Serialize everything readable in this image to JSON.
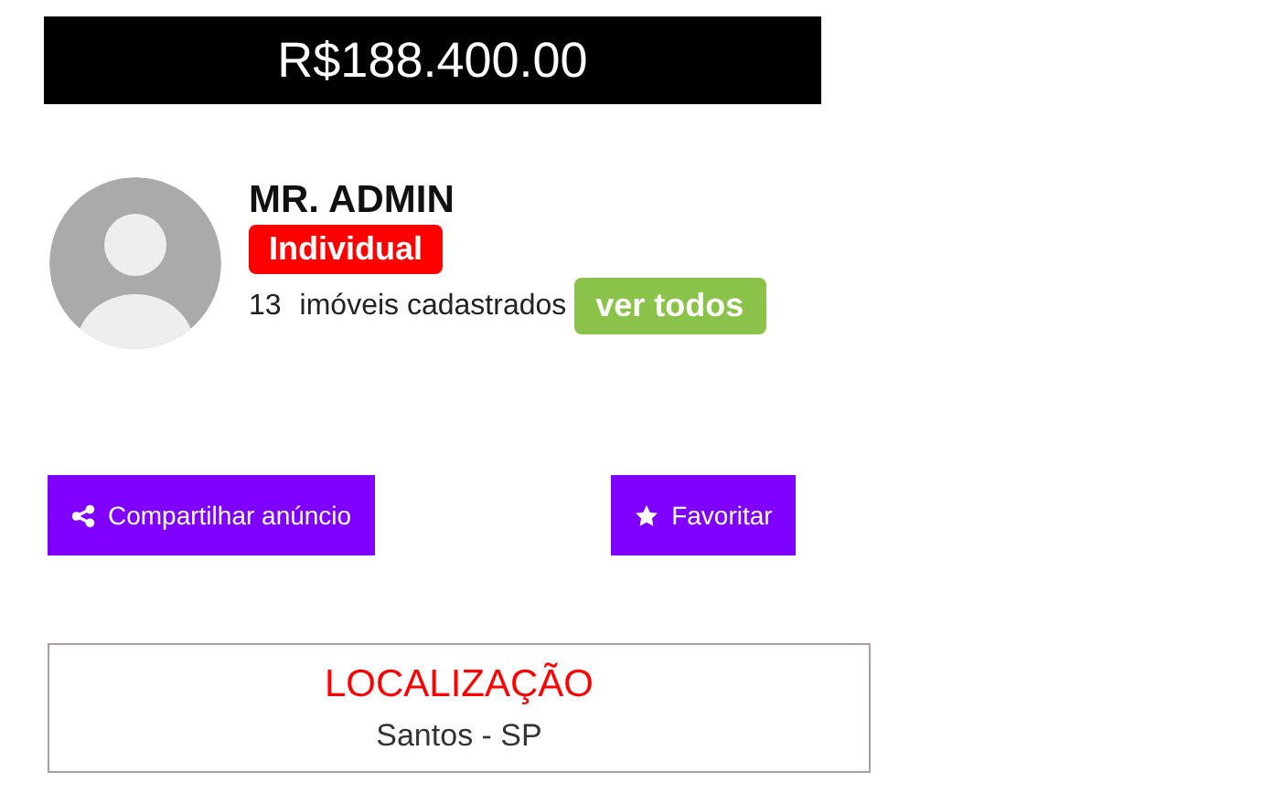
{
  "price": "R$188.400.00",
  "seller": {
    "name": "MR. ADMIN",
    "badge": "Individual",
    "count": "13",
    "count_label": "imóveis cadastrados",
    "view_all": "ver todos"
  },
  "actions": [
    {
      "kind": "share",
      "label": "Compartilhar anúncio"
    },
    {
      "kind": "favorite",
      "label": "Favoritar"
    }
  ],
  "location": {
    "title": "LOCALIZAÇÃO",
    "value": "Santos - SP"
  }
}
